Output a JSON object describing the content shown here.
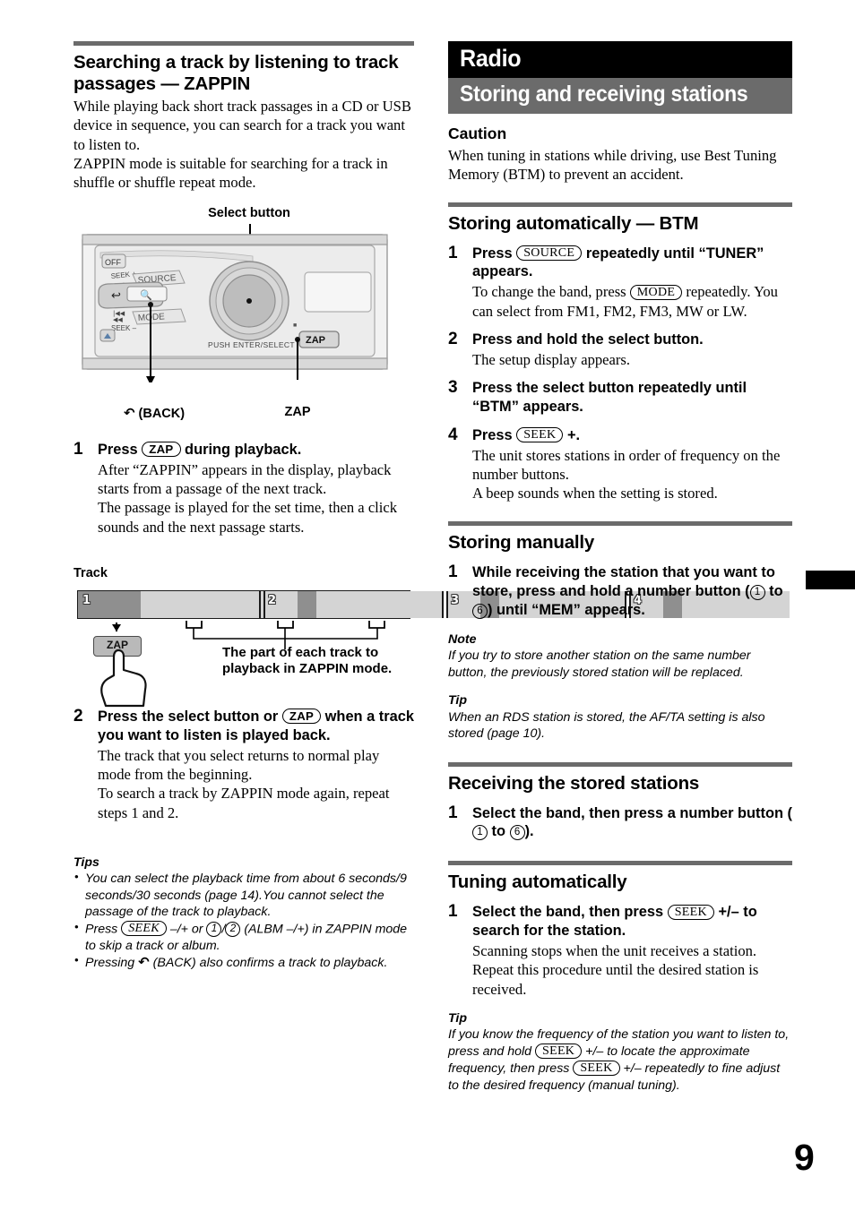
{
  "page": {
    "number": "9"
  },
  "left": {
    "heading": "Searching a track by listening to track passages — ZAPPIN",
    "intro": [
      "While playing back short track passages in a CD or USB device in sequence, you can search for a track you want to listen to.",
      "ZAPPIN mode is suitable for searching for a track in shuffle or shuffle repeat mode."
    ],
    "unit_figure": {
      "top_label": "Select button",
      "back_label": "(BACK)",
      "back_glyph": "↶",
      "zap_label": "ZAP",
      "face_labels": [
        "OFF",
        "SEEK +",
        "SOURCE",
        "MODE",
        "SEEK –",
        "PUSH ENTER/SELECT",
        "ZAP"
      ]
    },
    "steps": [
      {
        "num": "1",
        "lead_pre": "Press ",
        "lead_key": "ZAP",
        "lead_post": " during playback.",
        "detail": "After “ZAPPIN” appears in the display, playback starts from a passage of the next track.\nThe passage is played for the set time, then a click sounds and the next passage starts."
      },
      {
        "num": "2",
        "lead_pre": "Press the select button or ",
        "lead_key": "ZAP",
        "lead_post": " when a track you want to listen is played back.",
        "detail": "The track that you select returns to normal play mode from the beginning.\nTo search a track by ZAPPIN mode again, repeat steps 1 and 2."
      }
    ],
    "track_figure": {
      "title": "Track",
      "track_numbers": [
        "1",
        "2",
        "3",
        "4"
      ],
      "button_label": "ZAP",
      "caption": "The part of each track to playback in ZAPPIN mode."
    },
    "tips": {
      "heading": "Tips",
      "items": [
        "You can select the playback time from about 6 seconds/9 seconds/30 seconds (page 14).You cannot select the passage of the track to playback.",
        "Press (SEEK) –/+ or (1)/(2) (ALBM –/+) in ZAPPIN mode to skip a track or album.",
        "Pressing ↶ (BACK) also confirms a track to playback."
      ],
      "item2": {
        "a": "Press ",
        "key1": "SEEK",
        "b": " –/+ or ",
        "n1": "1",
        "slash": "/",
        "n2": "2",
        "c": " (ALBM –/+) in ZAPPIN mode to skip a track or album."
      },
      "item3": {
        "a": "Pressing ",
        "glyph": "↶",
        "b": " (BACK) also confirms a track to playback."
      }
    }
  },
  "right": {
    "banner_title": "Radio",
    "banner_subtitle": "Storing and receiving stations",
    "caution": {
      "heading": "Caution",
      "text": "When tuning in stations while driving, use Best Tuning Memory (BTM) to prevent an accident."
    },
    "sections": [
      {
        "heading": "Storing automatically — BTM",
        "steps": [
          {
            "num": "1",
            "lead_pre": "Press ",
            "lead_key": "SOURCE",
            "lead_post": " repeatedly until “TUNER” appears.",
            "detail_pre": "To change the band, press ",
            "detail_key": "MODE",
            "detail_post": " repeatedly. You can select from FM1, FM2, FM3, MW or LW."
          },
          {
            "num": "2",
            "lead_pre": "Press and hold the select button.",
            "detail_post": "The setup display appears."
          },
          {
            "num": "3",
            "lead_pre": "Press the select button repeatedly until “BTM” appears."
          },
          {
            "num": "4",
            "lead_pre": "Press ",
            "lead_key": "SEEK",
            "lead_post": " +.",
            "detail_post": "The unit stores stations in order of frequency on the number buttons.\nA beep sounds when the setting is stored."
          }
        ]
      },
      {
        "heading": "Storing manually",
        "step": {
          "num": "1",
          "a": "While receiving the station that you want to store, press and hold a number button (",
          "n1": "1",
          "mid": " to ",
          "n2": "6",
          "b": ") until “MEM” appears."
        },
        "note": {
          "heading": "Note",
          "text": "If you try to store another station on the same number button, the previously stored station will be replaced."
        },
        "tip": {
          "heading": "Tip",
          "text": "When an RDS station is stored, the AF/TA setting is also stored (page 10)."
        }
      },
      {
        "heading": "Receiving the stored stations",
        "step": {
          "num": "1",
          "a": "Select the band, then press a number button (",
          "n1": "1",
          "mid": " to ",
          "n2": "6",
          "b": ")."
        }
      },
      {
        "heading": "Tuning automatically",
        "step": {
          "num": "1",
          "a": "Select the band, then press ",
          "key": "SEEK",
          "b": " +/– to search for the station.",
          "detail": "Scanning stops when the unit receives a station. Repeat this procedure until the desired station is received."
        },
        "tip": {
          "heading": "Tip",
          "a": "If you know the frequency of the station you want to listen to, press and hold ",
          "key1": "SEEK",
          "b": " +/– to locate the approximate frequency, then press ",
          "key2": "SEEK",
          "c": " +/– repeatedly to fine adjust to the desired frequency (manual tuning)."
        }
      }
    ]
  },
  "colors": {
    "rule": "#6b6b6b",
    "banner_black": "#000000",
    "banner_gray": "#6b6b6b",
    "track_dark": "#8f8f8f",
    "track_light": "#d4d4d4"
  }
}
